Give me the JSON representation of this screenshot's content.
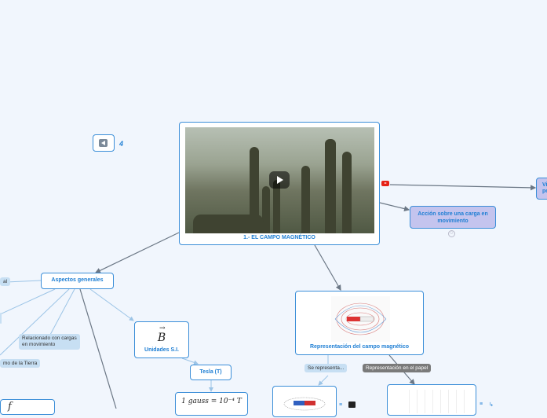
{
  "nodes": {
    "main_title": "1.- EL CAMPO MAGNÉTICO",
    "accion": "Acción sobre una carga en movimiento",
    "v_node": "Vi\npo",
    "aspectos": "Aspectos generales",
    "unidades": "Unidades S.I.",
    "unidades_symbol": "B",
    "tesla": "Tesla (T)",
    "gauss": "1 gauss = 10⁻⁴ T",
    "representacion": "Representación del campo magnético",
    "prev_count": "4"
  },
  "labels": {
    "relacionado": "Relacionado con cargas\nen movimiento",
    "tierra": "mo de la Tierra",
    "se_representa": "Se representa...",
    "papel": "Representación en el papel",
    "edge_l": "al"
  },
  "colors": {
    "accent": "#1f7fd4",
    "border": "#3b8ed8",
    "purple": "#c4c4ee",
    "link": "#6b7785"
  }
}
